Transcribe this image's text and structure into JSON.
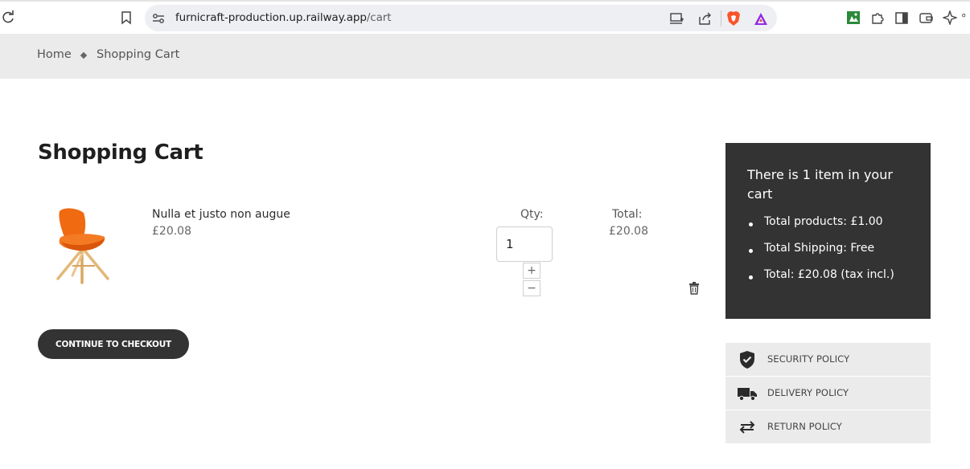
{
  "browser": {
    "url_host": "furnicraft-production.up.railway.app",
    "url_path": "/cart"
  },
  "breadcrumb": {
    "home": "Home",
    "current": "Shopping Cart"
  },
  "page_title": "Shopping Cart",
  "cart": {
    "items": [
      {
        "name": "Nulla et justo non augue",
        "price": "£20.08",
        "qty_label": "Qty:",
        "qty_value": "1",
        "total_label": "Total:",
        "total_value": "£20.08"
      }
    ],
    "qty_plus": "+",
    "qty_minus": "−",
    "checkout_label": "CONTINUE TO CHECKOUT"
  },
  "summary": {
    "title": "There is 1 item in your cart",
    "lines": [
      "Total products: £1.00",
      "Total Shipping: Free",
      "Total: £20.08 (tax incl.)"
    ]
  },
  "policies": [
    {
      "label": "SECURITY POLICY",
      "icon": "shield-check-icon"
    },
    {
      "label": "DELIVERY POLICY",
      "icon": "truck-icon"
    },
    {
      "label": "RETURN POLICY",
      "icon": "swap-arrows-icon"
    }
  ],
  "colors": {
    "dark": "#333333",
    "breadcrumb_bg": "#ebebeb",
    "chair_orange": "#f06a12"
  }
}
